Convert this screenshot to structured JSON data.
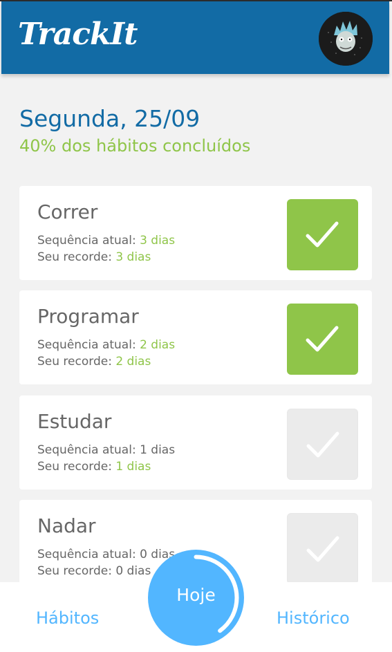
{
  "header": {
    "logo": "TrackIt",
    "avatar_icon": "rick-avatar-icon"
  },
  "today": {
    "date_title": "Segunda, 25/09",
    "progress_text": "40% dos hábitos concluídos",
    "progress_fraction": 0.4
  },
  "habits": [
    {
      "name": "Correr",
      "streak_label": "Sequência atual: ",
      "streak_value": "3 dias",
      "streak_highlight": true,
      "record_label": "Seu recorde: ",
      "record_value": "3 dias",
      "record_highlight": true,
      "done": true
    },
    {
      "name": "Programar",
      "streak_label": "Sequência atual: ",
      "streak_value": "2 dias",
      "streak_highlight": true,
      "record_label": "Seu recorde: ",
      "record_value": "2 dias",
      "record_highlight": true,
      "done": true
    },
    {
      "name": "Estudar",
      "streak_label": "Sequência atual: ",
      "streak_value": "1 dias",
      "streak_highlight": false,
      "record_label": "Seu recorde: ",
      "record_value": "1 dias",
      "record_highlight": true,
      "done": false
    },
    {
      "name": "Nadar",
      "streak_label": "Sequência atual: ",
      "streak_value": "0 dias",
      "streak_highlight": false,
      "record_label": "Seu recorde: ",
      "record_value": "0 dias",
      "record_highlight": false,
      "done": false
    }
  ],
  "footer": {
    "habits_label": "Hábitos",
    "today_label": "Hoje",
    "history_label": "Histórico"
  },
  "colors": {
    "header_bg": "#126BA5",
    "accent_green": "#8FC549",
    "accent_blue": "#52B6FF",
    "text_gray": "#666666",
    "check_inactive": "#EBEBEB"
  }
}
